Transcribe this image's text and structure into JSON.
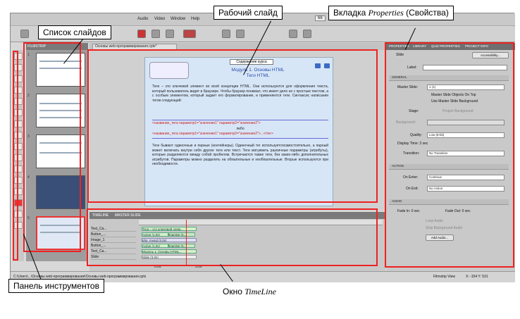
{
  "app": {
    "menu": [
      "Audio",
      "Video",
      "Window",
      "Help"
    ],
    "zoom": "66",
    "filmstrip_tab": "FILMSTRIP",
    "doc_tab": "Основы web-программирования.cptx*",
    "slide_numbers": [
      "1",
      "2",
      "3",
      "4",
      "5"
    ],
    "status_path": "C:\\Users\\...\\Основы web-программирования\\Основы web-программирования.cptx",
    "status_view": "Filmstrip View",
    "status_coords": "X: -154 Y: 531"
  },
  "slide": {
    "course_button": "Содержание курса",
    "title_line1": "Модуль 1. Основы HTML",
    "title_line2": "Теги HTML",
    "para1": "Теги – это ключевой элемент во всей концепции HTML. Они используются для оформления текста, который пользователь видит в браузере. Чтобы браузер понимал, что имеет дело не с простым текстом, а с особым элементом, который задает его форматирование, и применяются теги. Синтаксис написания тегов следующий:",
    "code1": "<название_тега параметр1=\"значение1\" параметр2=\"значение2\">",
    "code_or": "либо",
    "code2": "<название_тега параметр1=\"значение1\" параметр2=\"значение2\">...</тег>",
    "para2": "Теги бывают одиночные и парные (контейнеры). Одиночный тег используетсясамостоятельно, а парный может включать внутри себя другие теги или текст. Теги могуиметь различные параметры (атрибуты), которые разделяются между собой пробелом. Встречаются также теги, без каких-либо дополнительных атрибутов. Параметры можно разделить на обязательные и необязательные. Вторые используются при необходимости."
  },
  "timeline": {
    "tabs": [
      "TIMELINE",
      "MASTER SLIDE"
    ],
    "layers": [
      "Text_Ca...",
      "Button_...",
      "Image_1",
      "Button_...",
      "Text_Ca...",
      "Slide"
    ],
    "bars": [
      "Теги – это ключевой элем...",
      "Active (1.0s)",
      "php_mysql (3.0s)",
      "Active (1.0s)",
      "Модуль 1. Основы HTML...",
      "Slide (3.0s)"
    ],
    "inactive": "Inactive (1...",
    "time_left": "0.0s",
    "time_right": "3.0s"
  },
  "properties": {
    "tabs": [
      "PROPERTIES",
      "LIBRARY",
      "QUIZ PROPERTIES",
      "PROJECT INFO"
    ],
    "slide_label": "Slide",
    "accessibility": "Accessibility...",
    "label_field": "Label:",
    "general": "GENERAL",
    "master_slide_label": "Master Slide:",
    "master_slide_value": "1 (1)",
    "master_on_top": "Master Slide Objects On Top",
    "use_master_bg": "Use Master Slide Background",
    "stage": "Stage:",
    "project_bg": "Project Background",
    "background": "Background:",
    "quality_label": "Quality:",
    "quality_value": "Low (8-bit)",
    "display_time": "Display Time: 3 sec",
    "transition_label": "Transition:",
    "transition_value": "No Transition",
    "action": "ACTION",
    "on_enter_label": "On Enter:",
    "on_enter_value": "Continue",
    "on_exit_label": "On Exit:",
    "on_exit_value": "No Action",
    "audio": "AUDIO",
    "fade_in": "Fade In: 0 sec",
    "fade_out": "Fade Out: 0 sec",
    "loop_audio": "Loop Audio",
    "stop_bg_audio": "Stop Background Audio",
    "add_audio": "Add Audio..."
  },
  "callouts": {
    "slides_list": "Список слайдов",
    "work_slide": "Рабочий слайд",
    "props_prefix": "Вкладка ",
    "props_en": "Properties",
    "props_ru": " (Свойства)",
    "tools_panel": "Панель инструментов",
    "timeline_prefix": "Окно ",
    "timeline_en": "TimeLine"
  },
  "colors": {
    "highlight": "#e22222",
    "slide_bg": "#d7e6f7",
    "title_blue": "#2a4da8",
    "code_red": "#cc2222"
  }
}
